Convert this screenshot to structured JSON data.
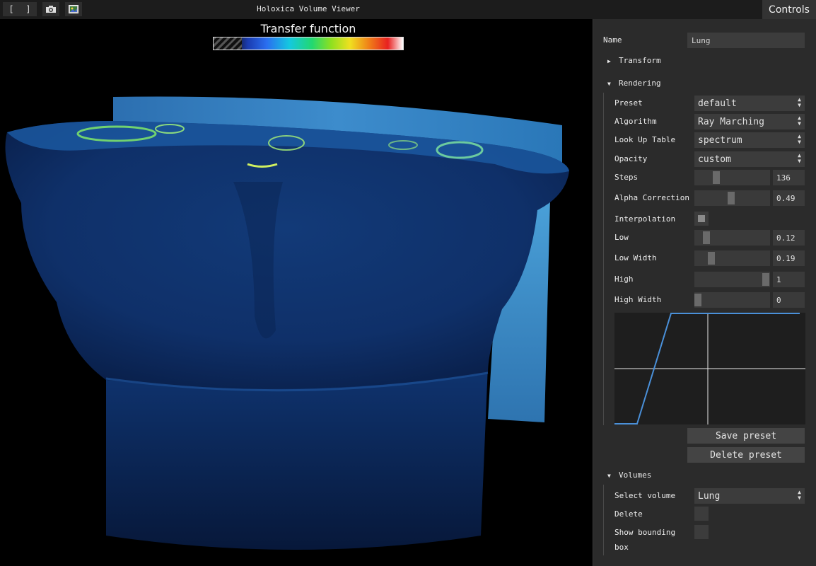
{
  "toolbar": {
    "icons": [
      "bracket-left-icon",
      "bracket-right-icon",
      "camera-icon",
      "image-icon"
    ],
    "bracket_left": "[",
    "bracket_right": "]"
  },
  "app_title": "Holoxica Volume Viewer",
  "controls_tab": "Controls",
  "viewport": {
    "transfer_function_title": "Transfer function"
  },
  "panel": {
    "name_label": "Name",
    "name_value": "Lung",
    "transform_label": "Transform",
    "rendering_label": "Rendering",
    "preset_label": "Preset",
    "preset_value": "default",
    "algorithm_label": "Algorithm",
    "algorithm_value": "Ray Marching",
    "lut_label": "Look Up Table",
    "lut_value": "spectrum",
    "opacity_label": "Opacity",
    "opacity_value": "custom",
    "steps_label": "Steps",
    "steps_value": "136",
    "alpha_label": "Alpha Correction",
    "alpha_value": "0.49",
    "interpolation_label": "Interpolation",
    "interpolation_checked": true,
    "low_label": "Low",
    "low_value": "0.12",
    "low_width_label": "Low Width",
    "low_width_value": "0.19",
    "high_label": "High",
    "high_value": "1",
    "high_width_label": "High Width",
    "high_width_value": "0",
    "save_preset": "Save preset",
    "delete_preset": "Delete preset",
    "volumes_label": "Volumes",
    "select_volume_label": "Select volume",
    "select_volume_value": "Lung",
    "delete_label": "Delete",
    "show_bbox_label_1": "Show bounding",
    "show_bbox_label_2": "box"
  },
  "colors": {
    "panel_bg": "#2b2b2b",
    "field_bg": "#3c3c3c",
    "curve": "#4a90d9",
    "volume_blue": "#1a4fa8"
  }
}
